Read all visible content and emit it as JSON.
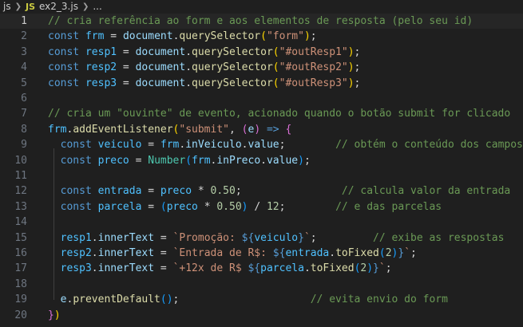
{
  "breadcrumb": {
    "folder": "js",
    "file_icon": "JS",
    "file": "ex2_3.js",
    "ellipsis": "..."
  },
  "editor": {
    "current_line": 1,
    "lines": [
      {
        "n": "1",
        "tokens": [
          {
            "t": "// cria referência ao form e aos elementos de resposta (pelo seu id)",
            "c": "cmt"
          }
        ]
      },
      {
        "n": "2",
        "tokens": [
          {
            "t": "const ",
            "c": "kw"
          },
          {
            "t": "frm",
            "c": "var"
          },
          {
            "t": " = ",
            "c": "txt"
          },
          {
            "t": "document",
            "c": "prop"
          },
          {
            "t": ".",
            "c": "txt"
          },
          {
            "t": "querySelector",
            "c": "fn"
          },
          {
            "t": "(",
            "c": "b1"
          },
          {
            "t": "\"form\"",
            "c": "str"
          },
          {
            "t": ")",
            "c": "b1"
          },
          {
            "t": ";",
            "c": "txt"
          }
        ]
      },
      {
        "n": "3",
        "tokens": [
          {
            "t": "const ",
            "c": "kw"
          },
          {
            "t": "resp1",
            "c": "var"
          },
          {
            "t": " = ",
            "c": "txt"
          },
          {
            "t": "document",
            "c": "prop"
          },
          {
            "t": ".",
            "c": "txt"
          },
          {
            "t": "querySelector",
            "c": "fn"
          },
          {
            "t": "(",
            "c": "b1"
          },
          {
            "t": "\"#outResp1\"",
            "c": "str"
          },
          {
            "t": ")",
            "c": "b1"
          },
          {
            "t": ";",
            "c": "txt"
          }
        ]
      },
      {
        "n": "4",
        "tokens": [
          {
            "t": "const ",
            "c": "kw"
          },
          {
            "t": "resp2",
            "c": "var"
          },
          {
            "t": " = ",
            "c": "txt"
          },
          {
            "t": "document",
            "c": "prop"
          },
          {
            "t": ".",
            "c": "txt"
          },
          {
            "t": "querySelector",
            "c": "fn"
          },
          {
            "t": "(",
            "c": "b1"
          },
          {
            "t": "\"#outResp2\"",
            "c": "str"
          },
          {
            "t": ")",
            "c": "b1"
          },
          {
            "t": ";",
            "c": "txt"
          }
        ]
      },
      {
        "n": "5",
        "tokens": [
          {
            "t": "const ",
            "c": "kw"
          },
          {
            "t": "resp3",
            "c": "var"
          },
          {
            "t": " = ",
            "c": "txt"
          },
          {
            "t": "document",
            "c": "prop"
          },
          {
            "t": ".",
            "c": "txt"
          },
          {
            "t": "querySelector",
            "c": "fn"
          },
          {
            "t": "(",
            "c": "b1"
          },
          {
            "t": "\"#outResp3\"",
            "c": "str"
          },
          {
            "t": ")",
            "c": "b1"
          },
          {
            "t": ";",
            "c": "txt"
          }
        ]
      },
      {
        "n": "6",
        "tokens": []
      },
      {
        "n": "7",
        "tokens": [
          {
            "t": "// cria um \"ouvinte\" de evento, acionado quando o botão submit for clicado",
            "c": "cmt"
          }
        ]
      },
      {
        "n": "8",
        "tokens": [
          {
            "t": "frm",
            "c": "var"
          },
          {
            "t": ".",
            "c": "txt"
          },
          {
            "t": "addEventListener",
            "c": "fn"
          },
          {
            "t": "(",
            "c": "b1"
          },
          {
            "t": "\"submit\"",
            "c": "str"
          },
          {
            "t": ", ",
            "c": "txt"
          },
          {
            "t": "(",
            "c": "b2"
          },
          {
            "t": "e",
            "c": "prop"
          },
          {
            "t": ")",
            "c": "b2"
          },
          {
            "t": " => ",
            "c": "kw"
          },
          {
            "t": "{",
            "c": "b2"
          }
        ]
      },
      {
        "n": "9",
        "tokens": [
          {
            "t": "  const ",
            "c": "kw"
          },
          {
            "t": "veiculo",
            "c": "var"
          },
          {
            "t": " = ",
            "c": "txt"
          },
          {
            "t": "frm",
            "c": "var"
          },
          {
            "t": ".",
            "c": "txt"
          },
          {
            "t": "inVeiculo",
            "c": "prop"
          },
          {
            "t": ".",
            "c": "txt"
          },
          {
            "t": "value",
            "c": "prop"
          },
          {
            "t": ";",
            "c": "txt"
          },
          {
            "t": "        // obtém o conteúdo dos campos",
            "c": "cmt"
          }
        ]
      },
      {
        "n": "10",
        "tokens": [
          {
            "t": "  const ",
            "c": "kw"
          },
          {
            "t": "preco",
            "c": "var"
          },
          {
            "t": " = ",
            "c": "txt"
          },
          {
            "t": "Number",
            "c": "cls"
          },
          {
            "t": "(",
            "c": "b3"
          },
          {
            "t": "frm",
            "c": "var"
          },
          {
            "t": ".",
            "c": "txt"
          },
          {
            "t": "inPreco",
            "c": "prop"
          },
          {
            "t": ".",
            "c": "txt"
          },
          {
            "t": "value",
            "c": "prop"
          },
          {
            "t": ")",
            "c": "b3"
          },
          {
            "t": ";",
            "c": "txt"
          }
        ]
      },
      {
        "n": "11",
        "tokens": []
      },
      {
        "n": "12",
        "tokens": [
          {
            "t": "  const ",
            "c": "kw"
          },
          {
            "t": "entrada",
            "c": "var"
          },
          {
            "t": " = ",
            "c": "txt"
          },
          {
            "t": "preco",
            "c": "var"
          },
          {
            "t": " * ",
            "c": "txt"
          },
          {
            "t": "0.50",
            "c": "num"
          },
          {
            "t": ";",
            "c": "txt"
          },
          {
            "t": "                // calcula valor da entrada",
            "c": "cmt"
          }
        ]
      },
      {
        "n": "13",
        "tokens": [
          {
            "t": "  const ",
            "c": "kw"
          },
          {
            "t": "parcela",
            "c": "var"
          },
          {
            "t": " = ",
            "c": "txt"
          },
          {
            "t": "(",
            "c": "b3"
          },
          {
            "t": "preco",
            "c": "var"
          },
          {
            "t": " * ",
            "c": "txt"
          },
          {
            "t": "0.50",
            "c": "num"
          },
          {
            "t": ")",
            "c": "b3"
          },
          {
            "t": " / ",
            "c": "txt"
          },
          {
            "t": "12",
            "c": "num"
          },
          {
            "t": ";",
            "c": "txt"
          },
          {
            "t": "        // e das parcelas",
            "c": "cmt"
          }
        ]
      },
      {
        "n": "14",
        "tokens": []
      },
      {
        "n": "15",
        "tokens": [
          {
            "t": "  resp1",
            "c": "var"
          },
          {
            "t": ".",
            "c": "txt"
          },
          {
            "t": "innerText",
            "c": "prop"
          },
          {
            "t": " = ",
            "c": "txt"
          },
          {
            "t": "`Promoção: ",
            "c": "str"
          },
          {
            "t": "${",
            "c": "tpl"
          },
          {
            "t": "veiculo",
            "c": "var"
          },
          {
            "t": "}",
            "c": "tpl"
          },
          {
            "t": "`",
            "c": "str"
          },
          {
            "t": ";",
            "c": "txt"
          },
          {
            "t": "         // exibe as respostas",
            "c": "cmt"
          }
        ]
      },
      {
        "n": "16",
        "tokens": [
          {
            "t": "  resp2",
            "c": "var"
          },
          {
            "t": ".",
            "c": "txt"
          },
          {
            "t": "innerText",
            "c": "prop"
          },
          {
            "t": " = ",
            "c": "txt"
          },
          {
            "t": "`Entrada de R$: ",
            "c": "str"
          },
          {
            "t": "${",
            "c": "tpl"
          },
          {
            "t": "entrada",
            "c": "var"
          },
          {
            "t": ".",
            "c": "txt"
          },
          {
            "t": "toFixed",
            "c": "fn"
          },
          {
            "t": "(",
            "c": "b3"
          },
          {
            "t": "2",
            "c": "num"
          },
          {
            "t": ")",
            "c": "b3"
          },
          {
            "t": "}",
            "c": "tpl"
          },
          {
            "t": "`",
            "c": "str"
          },
          {
            "t": ";",
            "c": "txt"
          }
        ]
      },
      {
        "n": "17",
        "tokens": [
          {
            "t": "  resp3",
            "c": "var"
          },
          {
            "t": ".",
            "c": "txt"
          },
          {
            "t": "innerText",
            "c": "prop"
          },
          {
            "t": " = ",
            "c": "txt"
          },
          {
            "t": "`+12x de R$ ",
            "c": "str"
          },
          {
            "t": "${",
            "c": "tpl"
          },
          {
            "t": "parcela",
            "c": "var"
          },
          {
            "t": ".",
            "c": "txt"
          },
          {
            "t": "toFixed",
            "c": "fn"
          },
          {
            "t": "(",
            "c": "b3"
          },
          {
            "t": "2",
            "c": "num"
          },
          {
            "t": ")",
            "c": "b3"
          },
          {
            "t": "}",
            "c": "tpl"
          },
          {
            "t": "`",
            "c": "str"
          },
          {
            "t": ";",
            "c": "txt"
          }
        ]
      },
      {
        "n": "18",
        "tokens": []
      },
      {
        "n": "19",
        "tokens": [
          {
            "t": "  e",
            "c": "prop"
          },
          {
            "t": ".",
            "c": "txt"
          },
          {
            "t": "preventDefault",
            "c": "fn"
          },
          {
            "t": "()",
            "c": "b3"
          },
          {
            "t": ";",
            "c": "txt"
          },
          {
            "t": "                     // evita envio do form",
            "c": "cmt"
          }
        ]
      },
      {
        "n": "20",
        "tokens": [
          {
            "t": "}",
            "c": "b2"
          },
          {
            "t": ")",
            "c": "b1"
          }
        ]
      }
    ]
  }
}
